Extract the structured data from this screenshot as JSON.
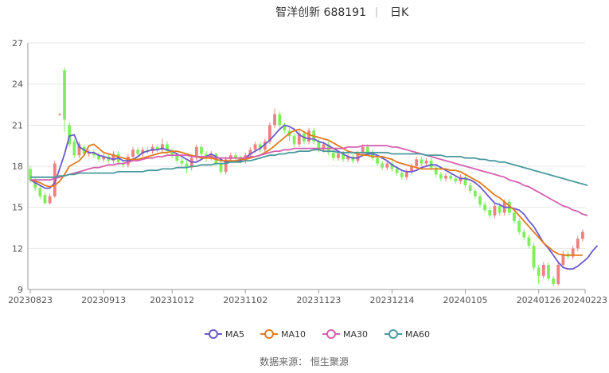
{
  "header": {
    "title": "智洋创新 688191",
    "separator": "|",
    "period": "日K"
  },
  "footer": {
    "source": "数据来源： 恒生聚源"
  },
  "chart_data": {
    "type": "candlestick",
    "title": "智洋创新 688191",
    "period": "日K",
    "ylim": [
      9,
      27
    ],
    "yticks": [
      9,
      12,
      15,
      18,
      21,
      24,
      27
    ],
    "x_tick_labels": [
      "20230823",
      "20230913",
      "20231012",
      "20231102",
      "20231123",
      "20231214",
      "20240105",
      "20240126",
      "20240223"
    ],
    "x_tick_positions": [
      0,
      15,
      29,
      44,
      59,
      74,
      89,
      104,
      119
    ],
    "grid": true,
    "legend_position": "bottom-center",
    "up_color": "#f08080",
    "down_color": "#7ef05b",
    "candles": [
      [
        17.8,
        17.0,
        18.0,
        16.8
      ],
      [
        17.0,
        16.4,
        17.2,
        16.2
      ],
      [
        16.4,
        15.8,
        16.6,
        15.6
      ],
      [
        15.9,
        15.3,
        16.1,
        15.2
      ],
      [
        15.3,
        15.8,
        16.0,
        15.2
      ],
      [
        15.8,
        18.2,
        18.4,
        15.7
      ],
      [
        21.8,
        21.8,
        21.9,
        21.7
      ],
      [
        25.0,
        21.4,
        25.2,
        20.5
      ],
      [
        21.0,
        19.6,
        21.2,
        19.4
      ],
      [
        19.8,
        18.8,
        20.0,
        18.6
      ],
      [
        18.8,
        19.6,
        19.8,
        18.6
      ],
      [
        19.4,
        18.9,
        19.6,
        18.7
      ],
      [
        18.9,
        19.0,
        19.2,
        18.7
      ],
      [
        19.0,
        18.8,
        19.2,
        18.6
      ],
      [
        18.8,
        18.5,
        19.0,
        18.3
      ],
      [
        18.5,
        18.7,
        18.9,
        18.3
      ],
      [
        18.7,
        18.4,
        18.9,
        18.2
      ],
      [
        18.4,
        18.9,
        19.1,
        18.2
      ],
      [
        18.9,
        18.3,
        19.1,
        18.1
      ],
      [
        18.2,
        18.1,
        18.4,
        17.9
      ],
      [
        18.1,
        18.7,
        18.9,
        17.9
      ],
      [
        18.7,
        19.2,
        19.4,
        18.5
      ],
      [
        19.2,
        18.9,
        19.4,
        18.7
      ],
      [
        18.9,
        19.2,
        19.4,
        18.7
      ],
      [
        19.2,
        19.1,
        19.4,
        18.9
      ],
      [
        19.1,
        19.4,
        19.6,
        18.9
      ],
      [
        19.4,
        19.2,
        19.6,
        19.0
      ],
      [
        19.2,
        19.6,
        20.0,
        19.0
      ],
      [
        19.6,
        19.1,
        19.8,
        18.9
      ],
      [
        19.1,
        18.8,
        19.3,
        18.6
      ],
      [
        18.8,
        18.4,
        19.0,
        18.2
      ],
      [
        18.4,
        18.2,
        18.6,
        18.0
      ],
      [
        18.2,
        17.9,
        18.4,
        17.5
      ],
      [
        17.9,
        18.6,
        18.8,
        17.7
      ],
      [
        18.6,
        19.4,
        19.6,
        18.4
      ],
      [
        19.4,
        18.9,
        19.6,
        18.7
      ],
      [
        18.9,
        18.6,
        19.1,
        18.3
      ],
      [
        18.6,
        18.9,
        19.1,
        18.4
      ],
      [
        18.9,
        18.2,
        19.0,
        18.0
      ],
      [
        18.2,
        17.6,
        18.4,
        17.4
      ],
      [
        17.6,
        18.5,
        18.7,
        17.4
      ],
      [
        18.5,
        18.8,
        19.0,
        18.3
      ],
      [
        18.8,
        18.6,
        19.0,
        18.4
      ],
      [
        18.6,
        18.4,
        18.8,
        18.2
      ],
      [
        18.4,
        18.8,
        19.0,
        18.2
      ],
      [
        18.8,
        19.2,
        19.4,
        18.6
      ],
      [
        19.2,
        19.6,
        19.8,
        19.0
      ],
      [
        19.6,
        19.2,
        19.8,
        19.0
      ],
      [
        19.2,
        19.8,
        20.0,
        19.0
      ],
      [
        19.8,
        21.0,
        21.2,
        19.6
      ],
      [
        21.0,
        21.8,
        22.2,
        20.8
      ],
      [
        21.8,
        21.0,
        22.0,
        20.8
      ],
      [
        21.0,
        20.6,
        21.2,
        20.4
      ],
      [
        20.6,
        20.2,
        20.8,
        19.8
      ],
      [
        20.2,
        19.6,
        20.4,
        19.4
      ],
      [
        19.6,
        20.4,
        20.6,
        19.4
      ],
      [
        20.4,
        19.8,
        20.6,
        19.6
      ],
      [
        19.8,
        20.6,
        20.8,
        19.6
      ],
      [
        20.6,
        19.8,
        20.8,
        19.6
      ],
      [
        19.8,
        19.2,
        20.0,
        19.0
      ],
      [
        19.2,
        19.6,
        19.8,
        19.0
      ],
      [
        19.6,
        19.0,
        19.8,
        18.8
      ],
      [
        19.0,
        18.6,
        19.2,
        18.4
      ],
      [
        18.6,
        18.9,
        19.1,
        18.4
      ],
      [
        18.9,
        18.5,
        19.1,
        18.3
      ],
      [
        18.5,
        18.7,
        18.9,
        18.3
      ],
      [
        18.7,
        18.4,
        18.9,
        18.2
      ],
      [
        18.4,
        18.9,
        19.1,
        18.2
      ],
      [
        18.9,
        19.4,
        19.6,
        18.7
      ],
      [
        19.4,
        19.0,
        19.6,
        18.8
      ],
      [
        19.0,
        18.6,
        19.2,
        18.4
      ],
      [
        18.6,
        18.2,
        18.8,
        18.0
      ],
      [
        18.2,
        17.9,
        18.4,
        17.7
      ],
      [
        17.9,
        18.2,
        18.4,
        17.7
      ],
      [
        18.2,
        17.8,
        18.4,
        17.6
      ],
      [
        17.8,
        17.5,
        18.0,
        17.3
      ],
      [
        17.5,
        17.2,
        17.7,
        17.0
      ],
      [
        17.2,
        17.6,
        17.8,
        17.0
      ],
      [
        17.6,
        18.0,
        18.2,
        17.4
      ],
      [
        18.0,
        18.5,
        18.7,
        17.8
      ],
      [
        18.5,
        18.2,
        18.7,
        18.0
      ],
      [
        18.2,
        18.4,
        18.6,
        18.0
      ],
      [
        18.4,
        17.9,
        18.6,
        17.7
      ],
      [
        17.9,
        17.4,
        18.1,
        17.2
      ],
      [
        17.4,
        17.1,
        17.6,
        16.9
      ],
      [
        17.1,
        17.3,
        17.5,
        16.9
      ],
      [
        17.3,
        17.1,
        17.5,
        16.9
      ],
      [
        17.1,
        16.9,
        17.3,
        16.7
      ],
      [
        16.9,
        17.2,
        17.4,
        16.7
      ],
      [
        17.2,
        16.6,
        17.4,
        16.4
      ],
      [
        16.6,
        16.2,
        16.8,
        16.0
      ],
      [
        16.2,
        15.8,
        16.4,
        15.6
      ],
      [
        15.8,
        15.2,
        16.0,
        15.0
      ],
      [
        15.2,
        14.8,
        15.4,
        14.6
      ],
      [
        14.8,
        14.4,
        15.0,
        14.2
      ],
      [
        14.4,
        15.1,
        15.3,
        14.2
      ],
      [
        15.1,
        14.6,
        15.3,
        14.4
      ],
      [
        14.6,
        15.4,
        15.6,
        14.4
      ],
      [
        15.4,
        14.6,
        15.6,
        14.4
      ],
      [
        14.6,
        14.0,
        14.8,
        13.8
      ],
      [
        14.0,
        13.2,
        14.2,
        13.0
      ],
      [
        13.2,
        12.8,
        13.4,
        12.6
      ],
      [
        12.8,
        12.2,
        13.0,
        12.0
      ],
      [
        12.2,
        10.6,
        12.4,
        10.4
      ],
      [
        10.6,
        10.0,
        10.8,
        9.4
      ],
      [
        10.0,
        10.8,
        11.0,
        9.8
      ],
      [
        10.8,
        9.8,
        11.0,
        9.6
      ],
      [
        9.8,
        9.4,
        10.0,
        9.2
      ],
      [
        9.4,
        10.8,
        11.0,
        9.3
      ],
      [
        10.8,
        11.6,
        11.8,
        10.6
      ],
      [
        11.6,
        11.4,
        11.8,
        11.2
      ],
      [
        11.4,
        12.0,
        12.2,
        11.2
      ],
      [
        12.0,
        12.7,
        12.9,
        11.8
      ],
      [
        12.7,
        13.2,
        13.4,
        12.5
      ]
    ],
    "series": [
      {
        "name": "MA5",
        "color": "#6a5acd",
        "values": [
          17.0,
          16.8,
          16.6,
          16.4,
          16.4,
          16.8,
          17.8,
          18.9,
          20.2,
          20.3,
          19.4,
          19.2,
          19.0,
          19.0,
          18.8,
          18.7,
          18.6,
          18.5,
          18.6,
          18.4,
          18.4,
          18.5,
          18.7,
          19.0,
          19.1,
          19.2,
          19.2,
          19.3,
          19.2,
          19.1,
          18.9,
          18.7,
          18.5,
          18.3,
          18.3,
          18.5,
          18.7,
          18.9,
          18.7,
          18.5,
          18.3,
          18.4,
          18.3,
          18.4,
          18.6,
          18.9,
          19.1,
          19.3,
          19.6,
          19.9,
          20.3,
          20.7,
          21.0,
          20.9,
          20.7,
          20.3,
          20.1,
          20.0,
          20.0,
          19.8,
          19.7,
          19.5,
          19.3,
          19.1,
          18.9,
          18.7,
          18.6,
          18.6,
          18.8,
          18.9,
          18.9,
          18.8,
          18.6,
          18.4,
          18.1,
          17.9,
          17.7,
          17.6,
          17.6,
          17.7,
          17.9,
          18.0,
          18.1,
          18.1,
          17.9,
          17.7,
          17.5,
          17.3,
          17.1,
          17.1,
          17.0,
          16.8,
          16.5,
          16.1,
          15.7,
          15.3,
          15.2,
          15.0,
          15.0,
          14.9,
          14.8,
          14.5,
          14.0,
          13.6,
          13.0,
          12.4,
          12.0,
          11.5,
          11.0,
          10.6,
          10.5,
          10.5,
          10.7,
          11.0,
          11.3,
          11.8,
          12.2
        ]
      },
      {
        "name": "MA10",
        "color": "#e07b1c",
        "values": [
          17.0,
          16.9,
          16.8,
          16.6,
          16.5,
          16.6,
          16.9,
          17.4,
          18.0,
          18.2,
          18.4,
          18.8,
          19.5,
          19.6,
          19.3,
          19.0,
          18.9,
          18.8,
          18.7,
          18.6,
          18.5,
          18.5,
          18.5,
          18.6,
          18.7,
          18.8,
          18.9,
          19.0,
          19.0,
          19.1,
          19.1,
          19.0,
          18.9,
          18.8,
          18.7,
          18.6,
          18.6,
          18.6,
          18.5,
          18.4,
          18.4,
          18.4,
          18.4,
          18.5,
          18.5,
          18.6,
          18.7,
          18.8,
          19.0,
          19.2,
          19.5,
          19.8,
          20.1,
          20.4,
          20.6,
          20.7,
          20.5,
          20.3,
          20.2,
          20.1,
          20.0,
          19.9,
          19.7,
          19.5,
          19.3,
          19.1,
          19.0,
          18.9,
          18.8,
          18.8,
          18.7,
          18.7,
          18.7,
          18.6,
          18.5,
          18.3,
          18.2,
          18.1,
          18.0,
          17.9,
          17.8,
          17.8,
          17.8,
          17.8,
          17.8,
          17.8,
          17.7,
          17.7,
          17.6,
          17.4,
          17.2,
          17.0,
          16.8,
          16.5,
          16.2,
          15.9,
          15.7,
          15.4,
          15.1,
          14.8,
          14.4,
          14.0,
          13.6,
          13.2,
          12.8,
          12.4,
          12.1,
          11.8,
          11.6,
          11.5,
          11.5,
          11.5,
          11.5,
          11.5
        ]
      },
      {
        "name": "MA30",
        "color": "#d65fb0",
        "values": [
          17.0,
          17.0,
          17.0,
          17.0,
          17.0,
          17.1,
          17.2,
          17.3,
          17.4,
          17.5,
          17.6,
          17.7,
          17.8,
          17.9,
          17.9,
          18.0,
          18.1,
          18.1,
          18.2,
          18.2,
          18.3,
          18.4,
          18.4,
          18.5,
          18.6,
          18.6,
          18.7,
          18.7,
          18.8,
          18.8,
          18.8,
          18.8,
          18.8,
          18.7,
          18.7,
          18.7,
          18.7,
          18.7,
          18.6,
          18.6,
          18.6,
          18.6,
          18.6,
          18.6,
          18.6,
          18.7,
          18.7,
          18.8,
          18.9,
          19.0,
          19.1,
          19.1,
          19.2,
          19.2,
          19.3,
          19.3,
          19.3,
          19.3,
          19.3,
          19.3,
          19.3,
          19.3,
          19.3,
          19.3,
          19.3,
          19.4,
          19.4,
          19.4,
          19.5,
          19.5,
          19.5,
          19.5,
          19.5,
          19.5,
          19.4,
          19.4,
          19.3,
          19.2,
          19.1,
          19.0,
          18.9,
          18.8,
          18.7,
          18.6,
          18.5,
          18.4,
          18.3,
          18.2,
          18.1,
          18.0,
          17.9,
          17.8,
          17.7,
          17.6,
          17.5,
          17.4,
          17.3,
          17.2,
          17.0,
          16.9,
          16.8,
          16.6,
          16.5,
          16.3,
          16.1,
          15.9,
          15.7,
          15.5,
          15.3,
          15.1,
          15.0,
          14.8,
          14.7,
          14.5,
          14.4
        ]
      },
      {
        "name": "MA60",
        "color": "#4a9a9c",
        "values": [
          17.2,
          17.2,
          17.2,
          17.2,
          17.2,
          17.2,
          17.3,
          17.3,
          17.4,
          17.4,
          17.5,
          17.5,
          17.5,
          17.5,
          17.5,
          17.5,
          17.5,
          17.5,
          17.6,
          17.6,
          17.6,
          17.6,
          17.6,
          17.6,
          17.7,
          17.7,
          17.7,
          17.8,
          17.8,
          17.8,
          17.9,
          17.9,
          17.9,
          18.0,
          18.0,
          18.1,
          18.1,
          18.1,
          18.2,
          18.2,
          18.2,
          18.3,
          18.3,
          18.3,
          18.4,
          18.4,
          18.5,
          18.6,
          18.7,
          18.8,
          18.8,
          18.9,
          18.9,
          19.0,
          19.0,
          19.1,
          19.1,
          19.1,
          19.2,
          19.2,
          19.1,
          19.1,
          19.1,
          19.0,
          19.0,
          19.0,
          19.0,
          19.0,
          19.0,
          19.0,
          19.0,
          19.0,
          19.0,
          19.0,
          18.9,
          18.9,
          18.9,
          18.9,
          18.9,
          18.9,
          18.9,
          18.8,
          18.8,
          18.8,
          18.8,
          18.7,
          18.7,
          18.7,
          18.7,
          18.6,
          18.6,
          18.6,
          18.5,
          18.5,
          18.4,
          18.4,
          18.3,
          18.3,
          18.2,
          18.1,
          18.0,
          17.9,
          17.8,
          17.7,
          17.6,
          17.5,
          17.4,
          17.3,
          17.2,
          17.1,
          17.0,
          16.9,
          16.8,
          16.7,
          16.6
        ]
      }
    ]
  }
}
